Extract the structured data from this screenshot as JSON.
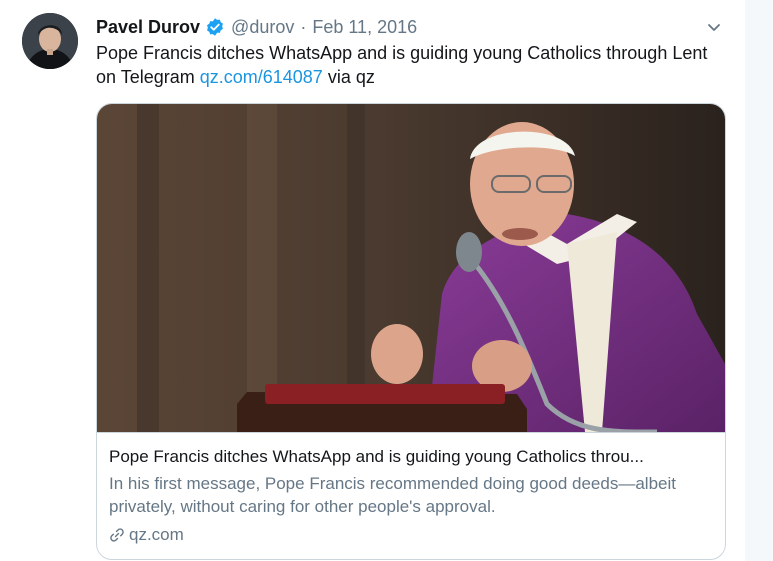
{
  "tweet": {
    "author_name": "Pavel Durov",
    "handle": "@durov",
    "separator": "·",
    "date": "Feb 11, 2016",
    "text_before_link": "Pope Francis ditches WhatsApp and is guiding young Catholics through Lent on Telegram ",
    "link_text": "qz.com/614087",
    "text_after_link": " via qz"
  },
  "card": {
    "title": "Pope Francis ditches WhatsApp and is guiding young Catholics throu...",
    "description": "In his first message, Pope Francis recommended doing good deeds—albeit privately, without caring for other people's approval.",
    "domain": "qz.com"
  },
  "icons": {
    "verified": "verified-badge-icon",
    "more": "chevron-down-icon",
    "link": "link-icon"
  },
  "colors": {
    "link": "#1b95e0",
    "verified": "#1da1f2",
    "secondary_text": "#657786",
    "robe": "#6b2c7a"
  }
}
